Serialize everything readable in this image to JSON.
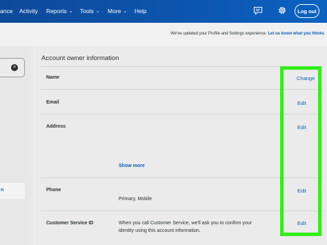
{
  "nav": {
    "items": [
      {
        "label": "ance",
        "has_dropdown": false
      },
      {
        "label": "Activity",
        "has_dropdown": false
      },
      {
        "label": "Reports",
        "has_dropdown": true
      },
      {
        "label": "Tools",
        "has_dropdown": true
      },
      {
        "label": "More",
        "has_dropdown": true
      },
      {
        "label": "Help",
        "has_dropdown": false
      }
    ],
    "icons": [
      "message-icon",
      "gear-icon"
    ],
    "logout_label": "Log out"
  },
  "notice": {
    "text": "We've updated your Profile and Settings experience.",
    "link": "Let us know what you thinks"
  },
  "sidebar": {
    "search_clear_icon": "clear-icon",
    "active_item_label": "n"
  },
  "card": {
    "title": "Account owner information",
    "rows": [
      {
        "label": "Name",
        "value": "",
        "action": "Change"
      },
      {
        "label": "Email",
        "value": "",
        "action": "Edit"
      },
      {
        "label": "Address",
        "value": "",
        "action": "Edit",
        "show_more": "Show more"
      },
      {
        "label": "Phone",
        "value": "Primary, Mobile",
        "action": "Edit"
      },
      {
        "label": "Customer Service ID",
        "value_line1": "When you call Customer Service, we'll ask you to confirm your",
        "value_line2": "identity using this account information.",
        "action": "Edit"
      }
    ]
  },
  "colors": {
    "nav_bg": "#0c55ae",
    "link": "#0b5fb5",
    "highlight": "#33ee1a",
    "page_bg": "#e9e9e9"
  }
}
